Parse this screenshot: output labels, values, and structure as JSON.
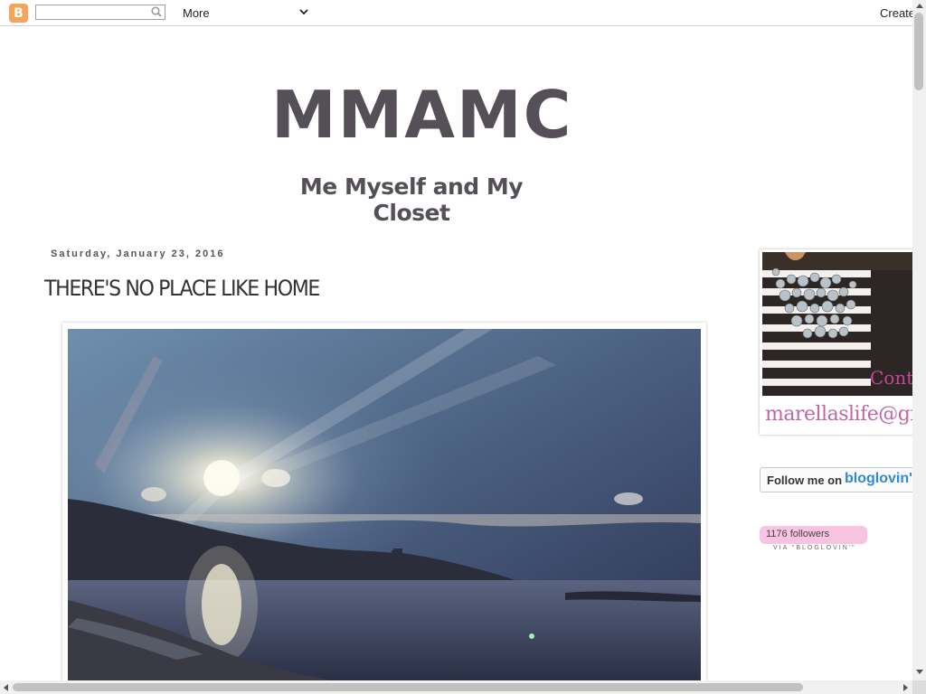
{
  "navbar": {
    "logo_letter": "B",
    "search_value": "",
    "more_label": "More",
    "create_label": "Create"
  },
  "header": {
    "title": "MMAMC",
    "description": "Me Myself and My Closet"
  },
  "post": {
    "date": "Saturday, January 23, 2016",
    "title": "THERE'S NO PLACE LIKE HOME"
  },
  "sidebar": {
    "contact_text": "Contact",
    "email_text": "marellaslife@gmail.com",
    "bloglovin_follow": "Follow me on",
    "bloglovin_brand": "bloglovin'",
    "followers": "1176 followers",
    "followers_via": "VIA \"BLOGLOVIN'\""
  },
  "colors": {
    "title_color": "#555057",
    "blogger_orange": "#f5a55b",
    "bloglovin_blue": "#2e8ad8",
    "followers_pink": "#f9c3e2"
  },
  "icons": {
    "logo": "blogger-logo-icon",
    "search": "search-icon",
    "dropdown": "chevron-down-icon"
  }
}
